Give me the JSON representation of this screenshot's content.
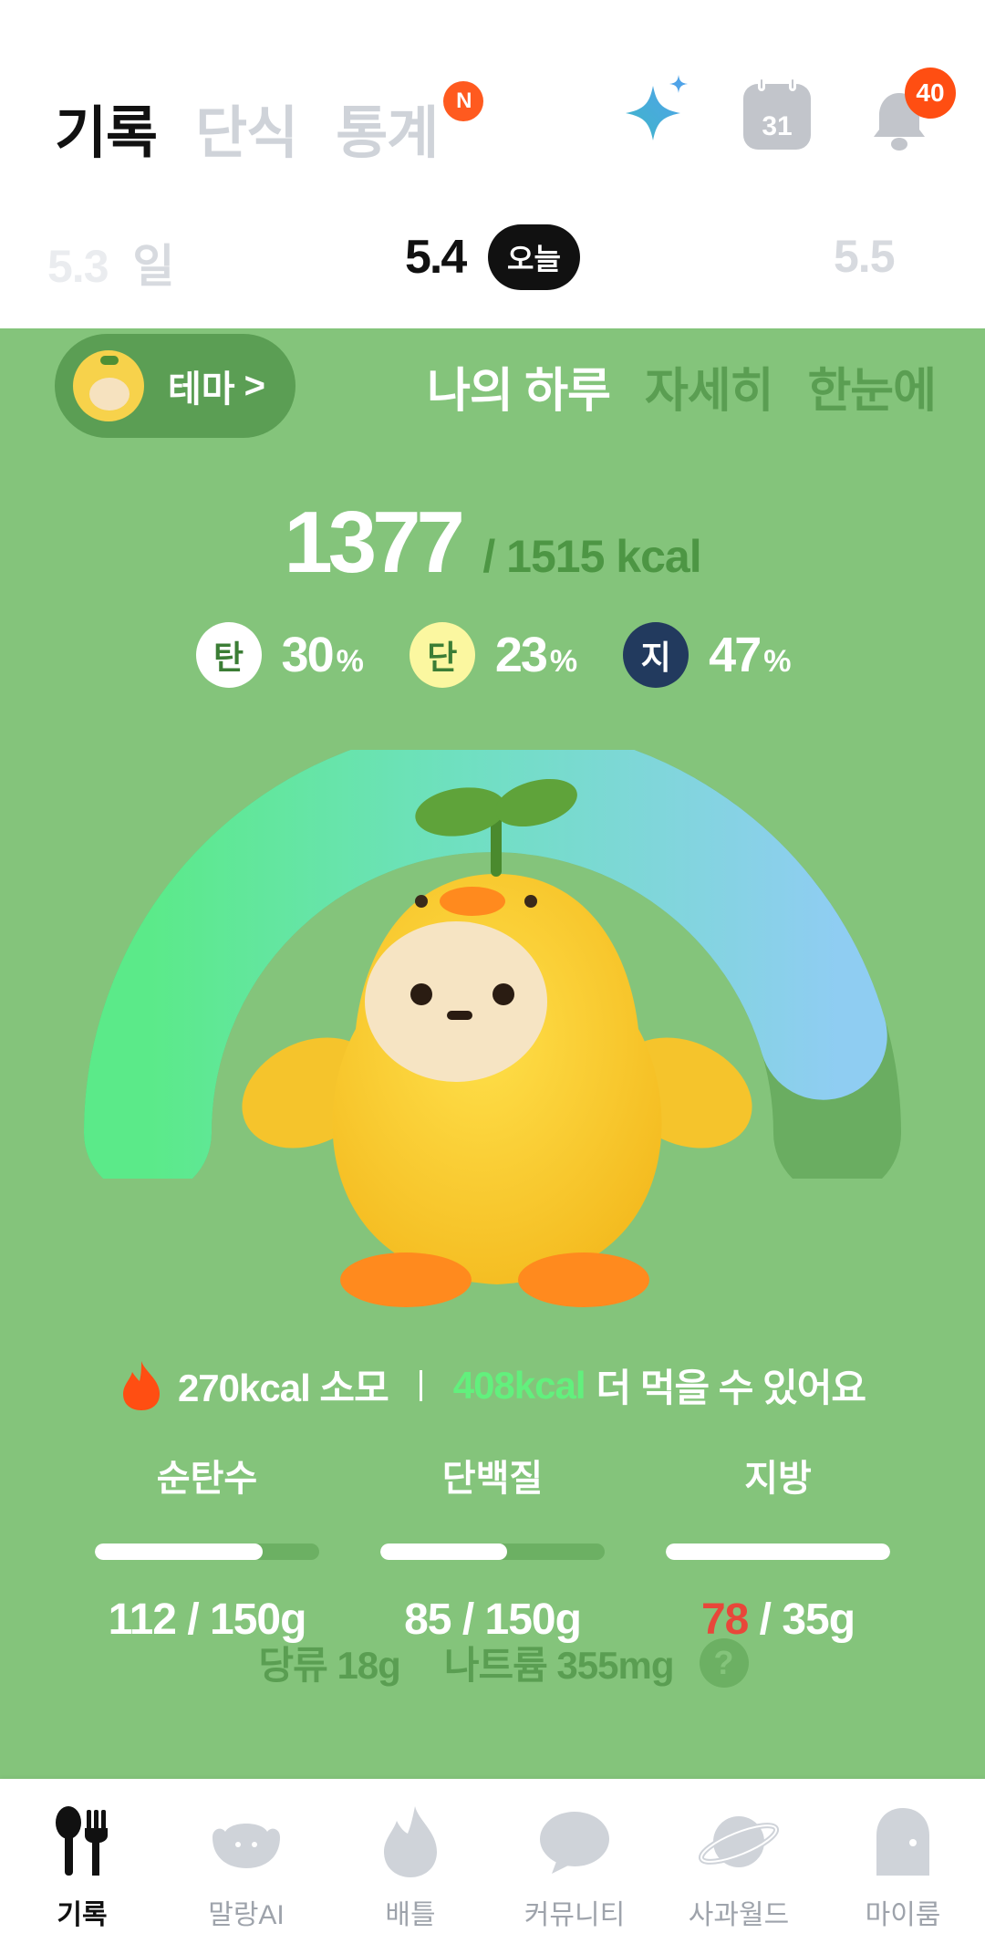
{
  "header": {
    "tabs": [
      {
        "label": "기록"
      },
      {
        "label": "단식"
      },
      {
        "label": "통계",
        "badge": "N"
      }
    ],
    "calendar_day": "31",
    "notification_count": "40"
  },
  "date_strip": {
    "prev_date": "5.3",
    "prev_weekday": "일",
    "current_date": "5.4",
    "today_label": "오늘",
    "next_date": "5.5"
  },
  "panel": {
    "theme_label": "테마",
    "theme_chevron": ">",
    "view_tabs": [
      {
        "label": "나의 하루"
      },
      {
        "label": "자세히"
      },
      {
        "label": "한눈에"
      }
    ],
    "kcal_consumed": "1377",
    "kcal_goal_text": "/ 1515 kcal",
    "macros": [
      {
        "symbol": "탄",
        "percent": "30",
        "unit": "%",
        "color": "#ffffff",
        "text_color": "#3b7d35"
      },
      {
        "symbol": "단",
        "percent": "23",
        "unit": "%",
        "color": "#fbf7a0",
        "text_color": "#3b7d35"
      },
      {
        "symbol": "지",
        "percent": "47",
        "unit": "%",
        "color": "#223a5e",
        "text_color": "#ffffff"
      }
    ],
    "burned_text": "270kcal 소모",
    "remaining_kcal": "408kcal",
    "remaining_text": "더 먹을 수 있어요",
    "nutrients": [
      {
        "label": "순탄수",
        "current": "112",
        "goal": "/ 150g",
        "progress": 0.747,
        "over": false
      },
      {
        "label": "단백질",
        "current": "85",
        "goal": "/ 150g",
        "progress": 0.567,
        "over": false
      },
      {
        "label": "지방",
        "current": "78",
        "goal": "/ 35g",
        "progress": 1.0,
        "over": true
      }
    ],
    "sugar_text": "당류 18g",
    "sodium_text": "나트륨 355mg",
    "help_symbol": "?",
    "gauge_progress": 0.909
  },
  "bottom_nav": [
    {
      "label": "기록",
      "icon": "utensils-icon"
    },
    {
      "label": "말랑AI",
      "icon": "blob-ai-icon"
    },
    {
      "label": "배틀",
      "icon": "flame-icon"
    },
    {
      "label": "커뮤니티",
      "icon": "chat-bubble-icon"
    },
    {
      "label": "사과월드",
      "icon": "planet-icon"
    },
    {
      "label": "마이룸",
      "icon": "ghost-room-icon"
    }
  ],
  "colors": {
    "panel_bg": "#84c47b",
    "accent_green": "#62f07d",
    "over_red": "#e8473a",
    "badge_orange": "#ff5a1f"
  }
}
